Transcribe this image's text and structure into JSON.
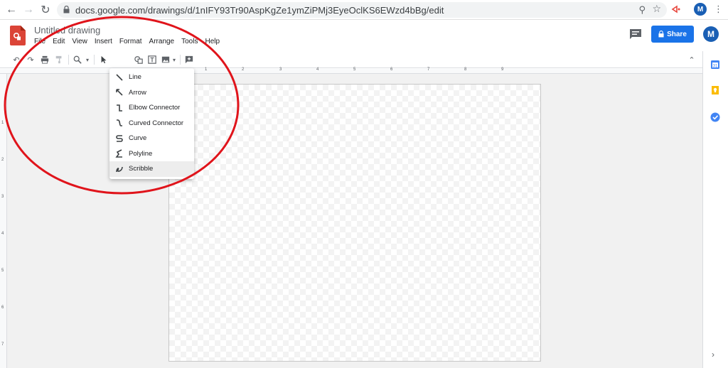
{
  "browser": {
    "url": "docs.google.com/drawings/d/1nIFY93Tr90AspKgZe1ymZiPMj3EyeOclKS6EWzd4bBg/edit",
    "profile_initial": "M"
  },
  "app": {
    "title": "Untitled drawing",
    "menu": [
      "File",
      "Edit",
      "View",
      "Insert",
      "Format",
      "Arrange",
      "Tools",
      "Help"
    ],
    "share_label": "Share",
    "profile_initial": "M",
    "accent_color": "#1a73e8"
  },
  "ruler": {
    "h_ticks": [
      "1",
      "2",
      "3",
      "4",
      "5",
      "6",
      "7",
      "8",
      "9"
    ],
    "v_ticks": [
      "1",
      "2",
      "3",
      "4",
      "5",
      "6",
      "7"
    ]
  },
  "line_menu": {
    "items": [
      {
        "label": "Line",
        "icon": "line-icon"
      },
      {
        "label": "Arrow",
        "icon": "arrow-icon"
      },
      {
        "label": "Elbow Connector",
        "icon": "elbow-connector-icon"
      },
      {
        "label": "Curved Connector",
        "icon": "curved-connector-icon"
      },
      {
        "label": "Curve",
        "icon": "curve-icon"
      },
      {
        "label": "Polyline",
        "icon": "polyline-icon"
      },
      {
        "label": "Scribble",
        "icon": "scribble-icon"
      }
    ],
    "highlighted": "Scribble"
  },
  "annotation": {
    "color": "#e0141b",
    "shape": "ellipse"
  }
}
